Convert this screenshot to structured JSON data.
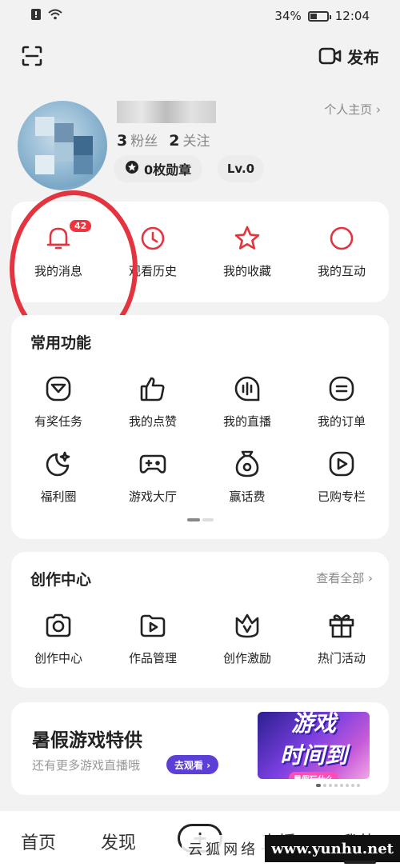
{
  "status_bar": {
    "battery": "34%",
    "time": "12:04"
  },
  "top_bar": {
    "publish_label": "发布"
  },
  "profile": {
    "followers_count": "3",
    "followers_label": "粉丝",
    "following_count": "2",
    "following_label": "关注",
    "homepage_link": "个人主页 ›",
    "badge_label": "0枚勋章",
    "level": "Lv.0"
  },
  "quick_actions": [
    {
      "label": "我的消息",
      "icon": "bell-icon",
      "badge": "42"
    },
    {
      "label": "观看历史",
      "icon": "clock-icon"
    },
    {
      "label": "我的收藏",
      "icon": "star-icon"
    },
    {
      "label": "我的互动",
      "icon": "circle-icon"
    }
  ],
  "common_functions": {
    "title": "常用功能",
    "items": [
      {
        "label": "有奖任务",
        "icon": "task-icon"
      },
      {
        "label": "我的点赞",
        "icon": "thumbs-up-icon"
      },
      {
        "label": "我的直播",
        "icon": "live-icon"
      },
      {
        "label": "我的订单",
        "icon": "order-icon"
      },
      {
        "label": "福利圈",
        "icon": "sparkle-moon-icon"
      },
      {
        "label": "游戏大厅",
        "icon": "gamepad-icon"
      },
      {
        "label": "赢话费",
        "icon": "money-bag-icon"
      },
      {
        "label": "已购专栏",
        "icon": "play-square-icon"
      }
    ]
  },
  "creation_center": {
    "title": "创作中心",
    "view_all": "查看全部 ›",
    "items": [
      {
        "label": "创作中心",
        "icon": "camera-icon"
      },
      {
        "label": "作品管理",
        "icon": "video-folder-icon"
      },
      {
        "label": "创作激励",
        "icon": "crown-icon"
      },
      {
        "label": "热门活动",
        "icon": "gift-icon"
      }
    ]
  },
  "promo": {
    "title": "暑假游戏特供",
    "subtitle": "还有更多游戏直播哦",
    "button": "去观看 ›",
    "art_line1": "游戏",
    "art_line2": "时间到",
    "art_sub": "暑假玩什么"
  },
  "bottom_nav": {
    "home": "首页",
    "discover": "发现",
    "plus": "+",
    "live": "直播",
    "mine": "我的"
  },
  "watermark": {
    "cn": "云狐网络",
    "en": "www.yunhu.net"
  },
  "colors": {
    "accent_red": "#e3343f",
    "promo_purple": "#5b3fd6"
  }
}
